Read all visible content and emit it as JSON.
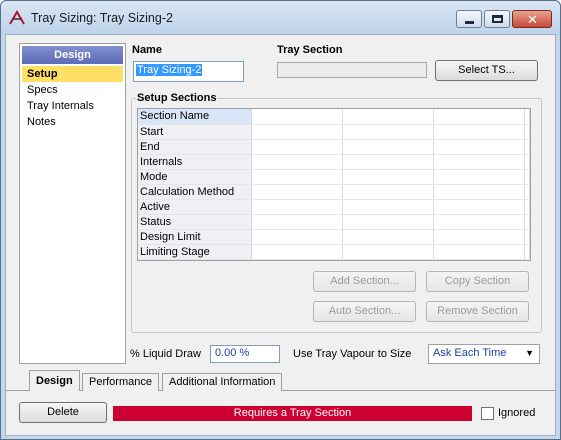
{
  "window": {
    "title": "Tray Sizing: Tray Sizing-2"
  },
  "nav": {
    "header": "Design",
    "items": [
      "Setup",
      "Specs",
      "Tray Internals",
      "Notes"
    ],
    "active": "Setup"
  },
  "name": {
    "label": "Name",
    "value": "Tray Sizing-2"
  },
  "tray_section": {
    "label": "Tray Section",
    "value": "",
    "select_button": "Select TS..."
  },
  "setup_sections": {
    "title": "Setup Sections",
    "rows": [
      "Section Name",
      "Start",
      "End",
      "Internals",
      "Mode",
      "Calculation Method",
      "Active",
      "Status",
      "Design Limit",
      "Limiting Stage"
    ],
    "buttons": {
      "add": "Add Section...",
      "copy": "Copy Section",
      "auto": "Auto Section...",
      "remove": "Remove Section"
    }
  },
  "liquid_draw": {
    "label": "% Liquid Draw",
    "value": "0.00 %"
  },
  "vapour": {
    "label": "Use Tray Vapour to Size",
    "selected": "Ask Each Time"
  },
  "tabs": [
    "Design",
    "Performance",
    "Additional Information"
  ],
  "active_tab": "Design",
  "footer": {
    "delete": "Delete",
    "status": "Requires a Tray Section",
    "status_color": "#cc0033",
    "ignored_label": "Ignored",
    "ignored_checked": false
  }
}
